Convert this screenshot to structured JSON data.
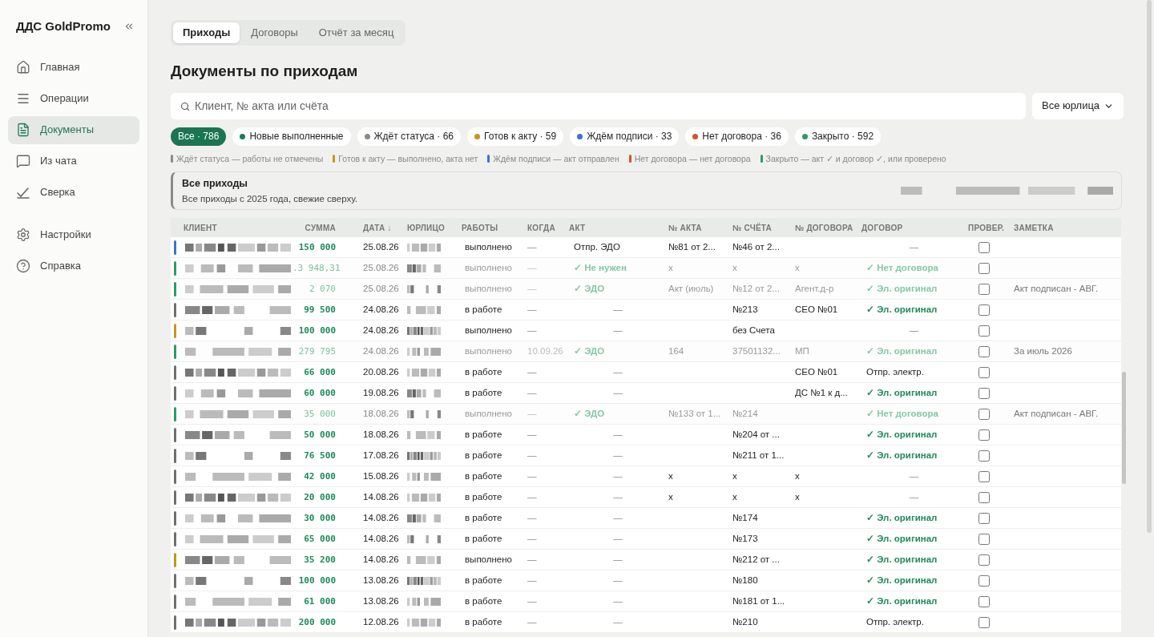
{
  "sidebar": {
    "title": "ДДС GoldPromo",
    "items": [
      {
        "label": "Главная",
        "selected": false
      },
      {
        "label": "Операции",
        "selected": false
      },
      {
        "label": "Документы",
        "selected": true
      },
      {
        "label": "Из чата",
        "selected": false
      },
      {
        "label": "Сверка",
        "selected": false
      },
      {
        "label": "Настройки",
        "selected": false
      },
      {
        "label": "Справка",
        "selected": false
      }
    ]
  },
  "tabs": [
    {
      "label": "Приходы",
      "selected": true
    },
    {
      "label": "Договоры",
      "selected": false
    },
    {
      "label": "Отчёт за месяц",
      "selected": false
    }
  ],
  "title": "Документы по приходам",
  "search": {
    "placeholder": "Клиент, № акта или счёта"
  },
  "entity_select": {
    "value": "Все юрлица"
  },
  "filters": [
    {
      "label": "Все · 786",
      "selected": true
    },
    {
      "label": "Новые выполненные",
      "selected": false,
      "color": "#1f7a55"
    },
    {
      "label": "Ждёт статуса · 66",
      "selected": false,
      "color": "#8a8a8a"
    },
    {
      "label": "Готов к акту · 59",
      "selected": false,
      "color": "#c8951c"
    },
    {
      "label": "Ждём подписи · 33",
      "selected": false,
      "color": "#3b72d4"
    },
    {
      "label": "Нет договора · 36",
      "selected": false,
      "color": "#d6532c"
    },
    {
      "label": "Закрыто · 592",
      "selected": false,
      "color": "#2e9a68"
    }
  ],
  "legend": [
    {
      "text": "Ждёт статуса — работы не отмечены",
      "color": "#8a8a8a"
    },
    {
      "text": "Готов к акту — выполнено, акта нет",
      "color": "#c8951c"
    },
    {
      "text": "Ждём подписи — акт отправлен",
      "color": "#3b72d4"
    },
    {
      "text": "Нет договора — нет договора",
      "color": "#d6532c"
    },
    {
      "text": "Закрыто — акт ✓ и договор ✓, или проверено",
      "color": "#2e9a68"
    }
  ],
  "info_card": {
    "title": "Все приходы",
    "text": "Все приходы с 2025 года, свежие сверху."
  },
  "table": {
    "columns": [
      "КЛИЕНТ",
      "СУММА",
      "ДАТА ↓",
      "ЮРЛИЦО",
      "РАБОТЫ",
      "КОГДА",
      "АКТ",
      "№ АКТА",
      "№ СЧЁТА",
      "№ ДОГОВОРА",
      "ДОГОВОР",
      "ПРОВЕР.",
      "ЗАМЕТКА"
    ],
    "rows": [
      {
        "color": "#3b72d4",
        "muted": false,
        "sum": "150 000",
        "date": "25.08.26",
        "works": "выполнено",
        "when": "—",
        "act": {
          "kind": "sent",
          "text": "Отпр. ЭДО"
        },
        "act_no": "№81 от 2...",
        "invoice_no": "№46 от 2...",
        "contract_no": "",
        "contract": {
          "kind": "none",
          "text": "—"
        },
        "checked": false,
        "note": ""
      },
      {
        "color": "#2e9a68",
        "muted": true,
        "sum": ".3 948,31",
        "date": "25.08.26",
        "works": "выполнено",
        "when": "—",
        "act": {
          "kind": "ok",
          "text": "✓ Не нужен"
        },
        "act_no": "x",
        "invoice_no": "x",
        "contract_no": "x",
        "contract": {
          "kind": "ok",
          "text": "✓ Нет договора"
        },
        "checked": false,
        "note": ""
      },
      {
        "color": "#2e9a68",
        "muted": true,
        "sum": "2 070",
        "date": "25.08.26",
        "works": "выполнено",
        "when": "—",
        "act": {
          "kind": "ok",
          "text": "✓ ЭДО"
        },
        "act_no": "Акт (июль)",
        "invoice_no": "№12 от 2...",
        "contract_no": "Агент.д-р",
        "contract": {
          "kind": "ok",
          "text": "✓ Эл. оригинал"
        },
        "checked": false,
        "note": "Акт подписан - АВГ."
      },
      {
        "color": "#6f6f6f",
        "muted": false,
        "sum": "99 500",
        "date": "24.08.26",
        "works": "в работе",
        "when": "—",
        "act": {
          "kind": "none",
          "text": "—"
        },
        "act_no": "",
        "invoice_no": "№213",
        "contract_no": "СЕО №01",
        "contract": {
          "kind": "ok",
          "text": "✓ Эл. оригинал"
        },
        "checked": false,
        "note": ""
      },
      {
        "color": "#c8951c",
        "muted": false,
        "sum": "100 000",
        "date": "24.08.26",
        "works": "выполнено",
        "when": "—",
        "act": {
          "kind": "none",
          "text": "—"
        },
        "act_no": "",
        "invoice_no": "без Счета",
        "contract_no": "",
        "contract": {
          "kind": "none",
          "text": "—"
        },
        "checked": false,
        "note": ""
      },
      {
        "color": "#2e9a68",
        "muted": true,
        "sum": "279 795",
        "date": "24.08.26",
        "works": "выполнено",
        "when": "10.09.26",
        "act": {
          "kind": "ok",
          "text": "✓ ЭДО"
        },
        "act_no": "164",
        "invoice_no": "37501132...",
        "contract_no": "МП",
        "contract": {
          "kind": "ok",
          "text": "✓ Эл. оригинал"
        },
        "checked": false,
        "note": "За июль 2026"
      },
      {
        "color": "#6f6f6f",
        "muted": false,
        "sum": "66 000",
        "date": "20.08.26",
        "works": "в работе",
        "when": "—",
        "act": {
          "kind": "none",
          "text": "—"
        },
        "act_no": "",
        "invoice_no": "",
        "contract_no": "СЕО №01",
        "contract": {
          "kind": "sent",
          "text": "Отпр. электр."
        },
        "checked": false,
        "note": ""
      },
      {
        "color": "#6f6f6f",
        "muted": false,
        "sum": "60 000",
        "date": "19.08.26",
        "works": "в работе",
        "when": "—",
        "act": {
          "kind": "none",
          "text": "—"
        },
        "act_no": "",
        "invoice_no": "",
        "contract_no": "ДС №1 к д...",
        "contract": {
          "kind": "ok",
          "text": "✓ Эл. оригинал"
        },
        "checked": false,
        "note": ""
      },
      {
        "color": "#2e9a68",
        "muted": true,
        "sum": "35 000",
        "date": "18.08.26",
        "works": "выполнено",
        "when": "—",
        "act": {
          "kind": "ok",
          "text": "✓ ЭДО"
        },
        "act_no": "№133 от 1...",
        "invoice_no": "№214",
        "contract_no": "",
        "contract": {
          "kind": "ok",
          "text": "✓ Нет договора"
        },
        "checked": false,
        "note": "Акт подписан - АВГ."
      },
      {
        "color": "#6f6f6f",
        "muted": false,
        "sum": "50 000",
        "date": "18.08.26",
        "works": "в работе",
        "when": "—",
        "act": {
          "kind": "none",
          "text": "—"
        },
        "act_no": "",
        "invoice_no": "№204 от ...",
        "contract_no": "",
        "contract": {
          "kind": "ok",
          "text": "✓ Эл. оригинал"
        },
        "checked": false,
        "note": ""
      },
      {
        "color": "#6f6f6f",
        "muted": false,
        "sum": "76 500",
        "date": "17.08.26",
        "works": "в работе",
        "when": "—",
        "act": {
          "kind": "none",
          "text": "—"
        },
        "act_no": "",
        "invoice_no": "№211 от 1...",
        "contract_no": "",
        "contract": {
          "kind": "ok",
          "text": "✓ Эл. оригинал"
        },
        "checked": false,
        "note": ""
      },
      {
        "color": "#6f6f6f",
        "muted": false,
        "sum": "42 000",
        "date": "15.08.26",
        "works": "в работе",
        "when": "—",
        "act": {
          "kind": "none",
          "text": "—"
        },
        "act_no": "x",
        "invoice_no": "x",
        "contract_no": "x",
        "contract": {
          "kind": "none",
          "text": "—"
        },
        "checked": false,
        "note": ""
      },
      {
        "color": "#6f6f6f",
        "muted": false,
        "sum": "20 000",
        "date": "14.08.26",
        "works": "в работе",
        "when": "—",
        "act": {
          "kind": "none",
          "text": "—"
        },
        "act_no": "x",
        "invoice_no": "x",
        "contract_no": "x",
        "contract": {
          "kind": "none",
          "text": "—"
        },
        "checked": false,
        "note": ""
      },
      {
        "color": "#6f6f6f",
        "muted": false,
        "sum": "30 000",
        "date": "14.08.26",
        "works": "в работе",
        "when": "—",
        "act": {
          "kind": "none",
          "text": "—"
        },
        "act_no": "",
        "invoice_no": "№174",
        "contract_no": "",
        "contract": {
          "kind": "ok",
          "text": "✓ Эл. оригинал"
        },
        "checked": false,
        "note": ""
      },
      {
        "color": "#6f6f6f",
        "muted": false,
        "sum": "65 000",
        "date": "14.08.26",
        "works": "в работе",
        "when": "—",
        "act": {
          "kind": "none",
          "text": "—"
        },
        "act_no": "",
        "invoice_no": "№173",
        "contract_no": "",
        "contract": {
          "kind": "ok",
          "text": "✓ Эл. оригинал"
        },
        "checked": false,
        "note": ""
      },
      {
        "color": "#c8951c",
        "muted": false,
        "sum": "35 200",
        "date": "14.08.26",
        "works": "выполнено",
        "when": "—",
        "act": {
          "kind": "none",
          "text": "—"
        },
        "act_no": "",
        "invoice_no": "№212 от ...",
        "contract_no": "",
        "contract": {
          "kind": "ok",
          "text": "✓ Эл. оригинал"
        },
        "checked": false,
        "note": ""
      },
      {
        "color": "#6f6f6f",
        "muted": false,
        "sum": "100 000",
        "date": "13.08.26",
        "works": "в работе",
        "when": "—",
        "act": {
          "kind": "none",
          "text": "—"
        },
        "act_no": "",
        "invoice_no": "№180",
        "contract_no": "",
        "contract": {
          "kind": "ok",
          "text": "✓ Эл. оригинал"
        },
        "checked": false,
        "note": ""
      },
      {
        "color": "#6f6f6f",
        "muted": false,
        "sum": "61 000",
        "date": "13.08.26",
        "works": "в работе",
        "when": "—",
        "act": {
          "kind": "none",
          "text": "—"
        },
        "act_no": "",
        "invoice_no": "№181 от 1...",
        "contract_no": "",
        "contract": {
          "kind": "ok",
          "text": "✓ Эл. оригинал"
        },
        "checked": false,
        "note": ""
      },
      {
        "color": "#6f6f6f",
        "muted": false,
        "sum": "200 000",
        "date": "12.08.26",
        "works": "в работе",
        "when": "—",
        "act": {
          "kind": "none",
          "text": "—"
        },
        "act_no": "",
        "invoice_no": "№210",
        "contract_no": "",
        "contract": {
          "kind": "sent",
          "text": "Отпр. электр."
        },
        "checked": false,
        "note": ""
      }
    ]
  }
}
